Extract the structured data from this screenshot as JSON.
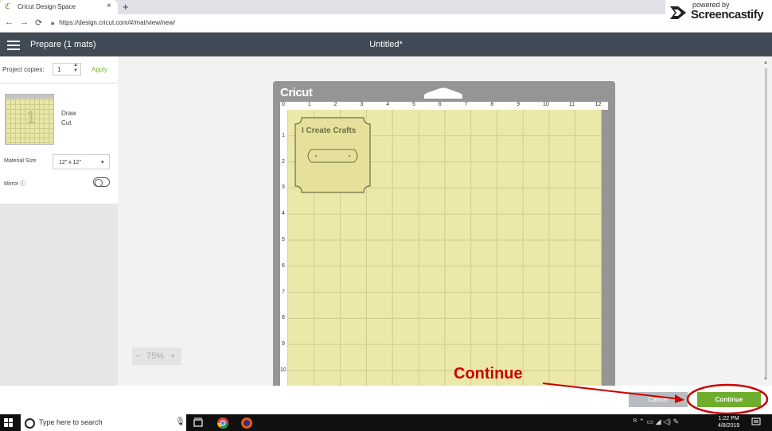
{
  "browser": {
    "tab_title": "Cricut Design Space",
    "tab_close": "×",
    "new_tab": "+",
    "url": "https://design.cricut.com/#/mat/view/new/",
    "nav": {
      "back": "←",
      "forward": "→",
      "reload": "⟳"
    }
  },
  "screencastify": {
    "powered_by": "powered by",
    "name": "Screencastify"
  },
  "app": {
    "prepare_label": "Prepare (1 mats)",
    "doc_title": "Untitled*"
  },
  "left_panel": {
    "project_copies_label": "Project copies:",
    "project_copies_value": "1",
    "apply_label": "Apply",
    "mat_number": "1",
    "mat_modes": [
      "Draw",
      "Cut"
    ],
    "material_size_label": "Material Size",
    "material_size_value": "12\" x 12\"",
    "mirror_label": "Mirror ⓘ",
    "mirror_on": false
  },
  "zoom": {
    "minus": "−",
    "level": "75%",
    "plus": "+"
  },
  "mat": {
    "brand": "Cricut",
    "ruler_x": [
      "0",
      "1",
      "2",
      "3",
      "4",
      "5",
      "6",
      "7",
      "8",
      "9",
      "10",
      "11",
      "12"
    ],
    "ruler_y": [
      "1",
      "2",
      "3",
      "4",
      "5",
      "6",
      "7",
      "8",
      "9",
      "10"
    ],
    "design_text": "I Create Crafts"
  },
  "buttons": {
    "cancel": "Cancel",
    "continue": "Continue"
  },
  "annotation": {
    "text": "Continue",
    "color": "#cc0000"
  },
  "taskbar": {
    "search_placeholder": "Type here to search",
    "time": "1:22 PM",
    "date": "4/8/2019"
  },
  "colors": {
    "header_bg": "#414b56",
    "accent_green": "#6fae2d",
    "mat_yellow": "#ebe8a9"
  }
}
